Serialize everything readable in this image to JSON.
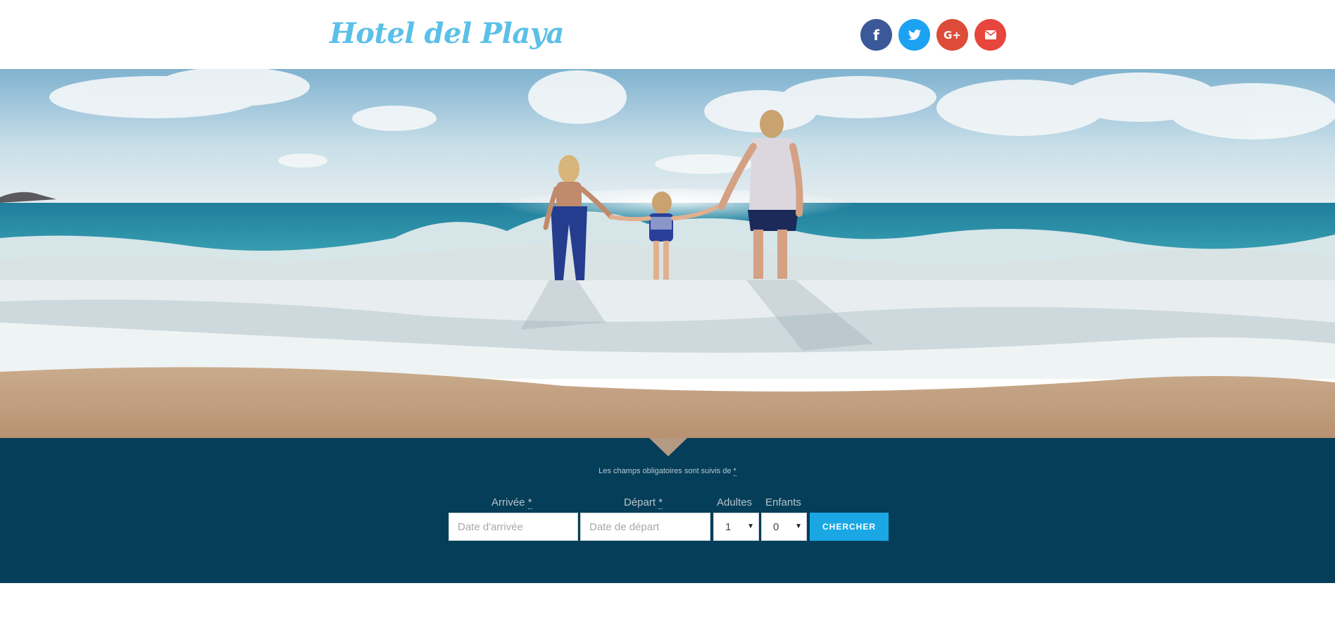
{
  "header": {
    "logo": "Hotel del Playa",
    "social": [
      {
        "name": "facebook",
        "glyph": "f",
        "color": "#3b5998"
      },
      {
        "name": "twitter",
        "glyph": "twitter-bird",
        "color": "#1da1f2"
      },
      {
        "name": "google-plus",
        "glyph": "G+",
        "color": "#dd4b39"
      },
      {
        "name": "email",
        "glyph": "envelope",
        "color": "#e8453c"
      }
    ]
  },
  "hero": {
    "image": "beach-family-photo"
  },
  "booking": {
    "required_note": "Les champs obligatoires sont suivis de",
    "required_star": "*",
    "arrival_label": "Arrivée",
    "departure_label": "Départ",
    "adults_label": "Adultes",
    "children_label": "Enfants",
    "arrival_placeholder": "Date d'arrivée",
    "departure_placeholder": "Date de départ",
    "adults_value": "1",
    "children_value": "0",
    "search_button": "CHERCHER",
    "band_color": "#043e58",
    "accent_color": "#1aa7e4"
  }
}
